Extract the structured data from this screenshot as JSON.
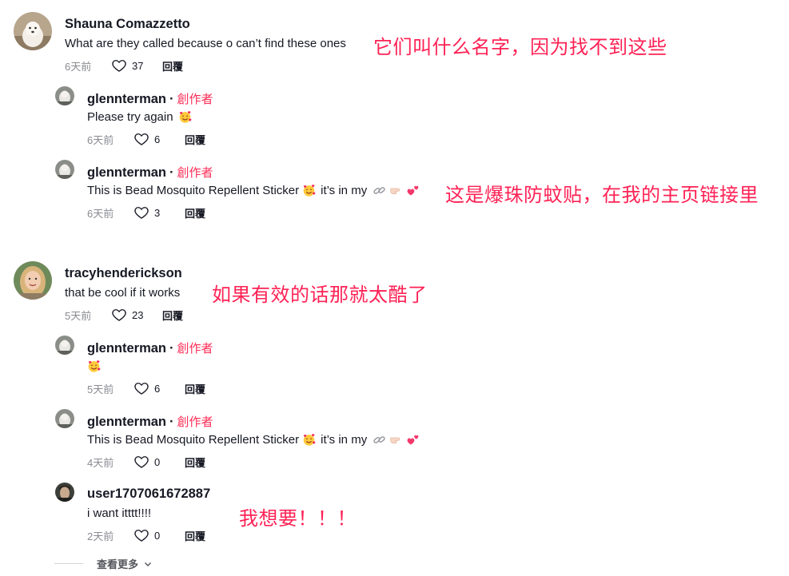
{
  "comments": [
    {
      "username": "Shauna Comazzetto",
      "text": "What are they called because o can’t find these ones",
      "time": "6天前",
      "likes": "37",
      "reply_label": "回覆",
      "annotation": "它们叫什么名字，因为找不到这些",
      "replies": [
        {
          "username": "glennterman",
          "creator_label": "創作者",
          "text": "Please try again",
          "time": "6天前",
          "likes": "6",
          "reply_label": "回覆"
        },
        {
          "username": "glennterman",
          "creator_label": "創作者",
          "text": "This is Bead Mosquito Repellent Sticker",
          "text_tail": "it’s in my",
          "time": "6天前",
          "likes": "3",
          "reply_label": "回覆",
          "annotation": "这是爆珠防蚊贴，在我的主页链接里"
        }
      ]
    },
    {
      "username": "tracyhenderickson",
      "text": "that be cool if it works",
      "time": "5天前",
      "likes": "23",
      "reply_label": "回覆",
      "annotation": "如果有效的话那就太酷了",
      "replies": [
        {
          "username": "glennterman",
          "creator_label": "創作者",
          "text": "",
          "time": "5天前",
          "likes": "6",
          "reply_label": "回覆"
        },
        {
          "username": "glennterman",
          "creator_label": "創作者",
          "text": "This is Bead Mosquito Repellent Sticker",
          "text_tail": "it’s in my",
          "time": "4天前",
          "likes": "0",
          "reply_label": "回覆"
        },
        {
          "username": "user1707061672887",
          "text": "i want itttt!!!!",
          "time": "2天前",
          "likes": "0",
          "reply_label": "回覆",
          "annotation": "我想要！！！"
        }
      ]
    }
  ],
  "view_more_label": "查看更多",
  "colors": {
    "creator": "#fe2c55",
    "annotation": "#ff2255",
    "meta": "#8a8b91"
  },
  "icons": [
    "heart-icon",
    "smiling-face-with-hearts-emoji",
    "link-icon",
    "pointing-hand-emoji",
    "two-hearts-emoji",
    "chevron-down-icon"
  ]
}
